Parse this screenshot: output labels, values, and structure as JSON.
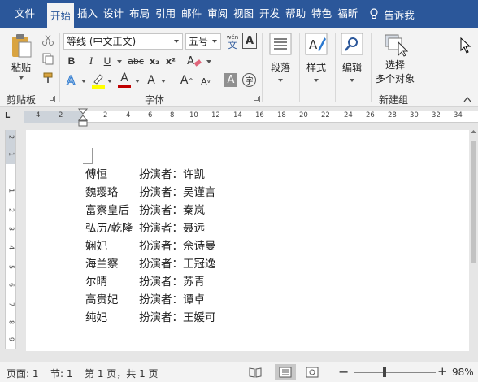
{
  "tabs": [
    {
      "label": "文件"
    },
    {
      "label": "开始"
    },
    {
      "label": "插入"
    },
    {
      "label": "设计"
    },
    {
      "label": "布局"
    },
    {
      "label": "引用"
    },
    {
      "label": "邮件"
    },
    {
      "label": "审阅"
    },
    {
      "label": "视图"
    },
    {
      "label": "开发"
    },
    {
      "label": "帮助"
    },
    {
      "label": "特色"
    },
    {
      "label": "福昕"
    }
  ],
  "active_tab": "开始",
  "tell_me": "告诉我",
  "ribbon": {
    "clipboard": {
      "paste_label": "粘贴",
      "group_label": "剪贴板"
    },
    "font": {
      "font_name": "等线 (中文正文)",
      "font_size": "五号",
      "wen_label": "wén",
      "wen_char": "文",
      "bold": "B",
      "italic": "I",
      "underline": "U",
      "strike": "abc",
      "subscript": "x₂",
      "superscript": "x²",
      "a_label": "A",
      "grow": "A",
      "shrink": "A",
      "char_shade": "A",
      "enclose": "字",
      "group_label": "字体"
    },
    "paragraph": {
      "label": "段落"
    },
    "styles": {
      "label": "样式"
    },
    "editing": {
      "label": "编辑"
    },
    "new_group": {
      "select_line1": "选择",
      "select_line2": "多个对象",
      "group_label": "新建组"
    }
  },
  "ruler": {
    "ticks": [
      "4",
      "2",
      "2",
      "4",
      "6",
      "8",
      "10",
      "12",
      "14",
      "16",
      "18",
      "20",
      "22",
      "24",
      "26",
      "28",
      "30",
      "32",
      "34"
    ],
    "tab_selector": "L"
  },
  "vruler": {
    "ticks": [
      "2",
      "1",
      "1",
      "2",
      "3",
      "4",
      "5",
      "6",
      "7",
      "8",
      "9",
      "10"
    ]
  },
  "document": {
    "rows": [
      {
        "role": "傅恒",
        "actor_label": "扮演者：许凯"
      },
      {
        "role": "魏璎珞",
        "actor_label": "扮演者：吴谨言"
      },
      {
        "role": "富察皇后",
        "actor_label": "扮演者：秦岚"
      },
      {
        "role": "弘历/乾隆",
        "actor_label": "扮演者：聂远"
      },
      {
        "role": "娴妃",
        "actor_label": "扮演者：佘诗曼"
      },
      {
        "role": "海兰察",
        "actor_label": "扮演者：王冠逸"
      },
      {
        "role": "尔晴",
        "actor_label": "扮演者：苏青"
      },
      {
        "role": "高贵妃",
        "actor_label": "扮演者：谭卓"
      },
      {
        "role": "纯妃",
        "actor_label": "扮演者：王媛可"
      }
    ]
  },
  "status": {
    "page": "页面: 1",
    "section": "节: 1",
    "page_of": "第 1 页，共 1 页",
    "zoom_minus": "−",
    "zoom_plus": "+",
    "zoom": "98%"
  },
  "colors": {
    "accent": "#2b579a",
    "highlight": "#ffff00",
    "font_color": "#c00000"
  }
}
